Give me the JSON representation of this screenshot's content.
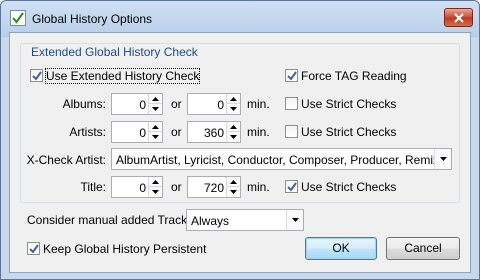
{
  "window": {
    "title": "Global History Options"
  },
  "group": {
    "title": "Extended Global History Check"
  },
  "use_extended": {
    "label": "Use Extended History Check",
    "checked": true
  },
  "force_tag": {
    "label": "Force TAG Reading",
    "checked": true
  },
  "albums": {
    "label": "Albums:",
    "value1": "0",
    "or": "or",
    "value2": "0",
    "unit": "min.",
    "strict_label": "Use Strict Checks",
    "strict_checked": false
  },
  "artists": {
    "label": "Artists:",
    "value1": "0",
    "or": "or",
    "value2": "360",
    "unit": "min.",
    "strict_label": "Use Strict Checks",
    "strict_checked": false
  },
  "xcheck": {
    "label": "X-Check Artist:",
    "value": "AlbumArtist, Lyricist, Conductor, Composer, Producer, Remixer"
  },
  "title_row": {
    "label": "Title:",
    "value1": "0",
    "or": "or",
    "value2": "720",
    "unit": "min.",
    "strict_label": "Use Strict Checks",
    "strict_checked": true
  },
  "manual": {
    "label": "Consider manual added Tracks:",
    "value": "Always"
  },
  "keep": {
    "label": "Keep Global History Persistent",
    "checked": true
  },
  "buttons": {
    "ok": "OK",
    "cancel": "Cancel"
  },
  "icons": {
    "app": "checkmark-doc-icon",
    "close": "close-icon"
  }
}
